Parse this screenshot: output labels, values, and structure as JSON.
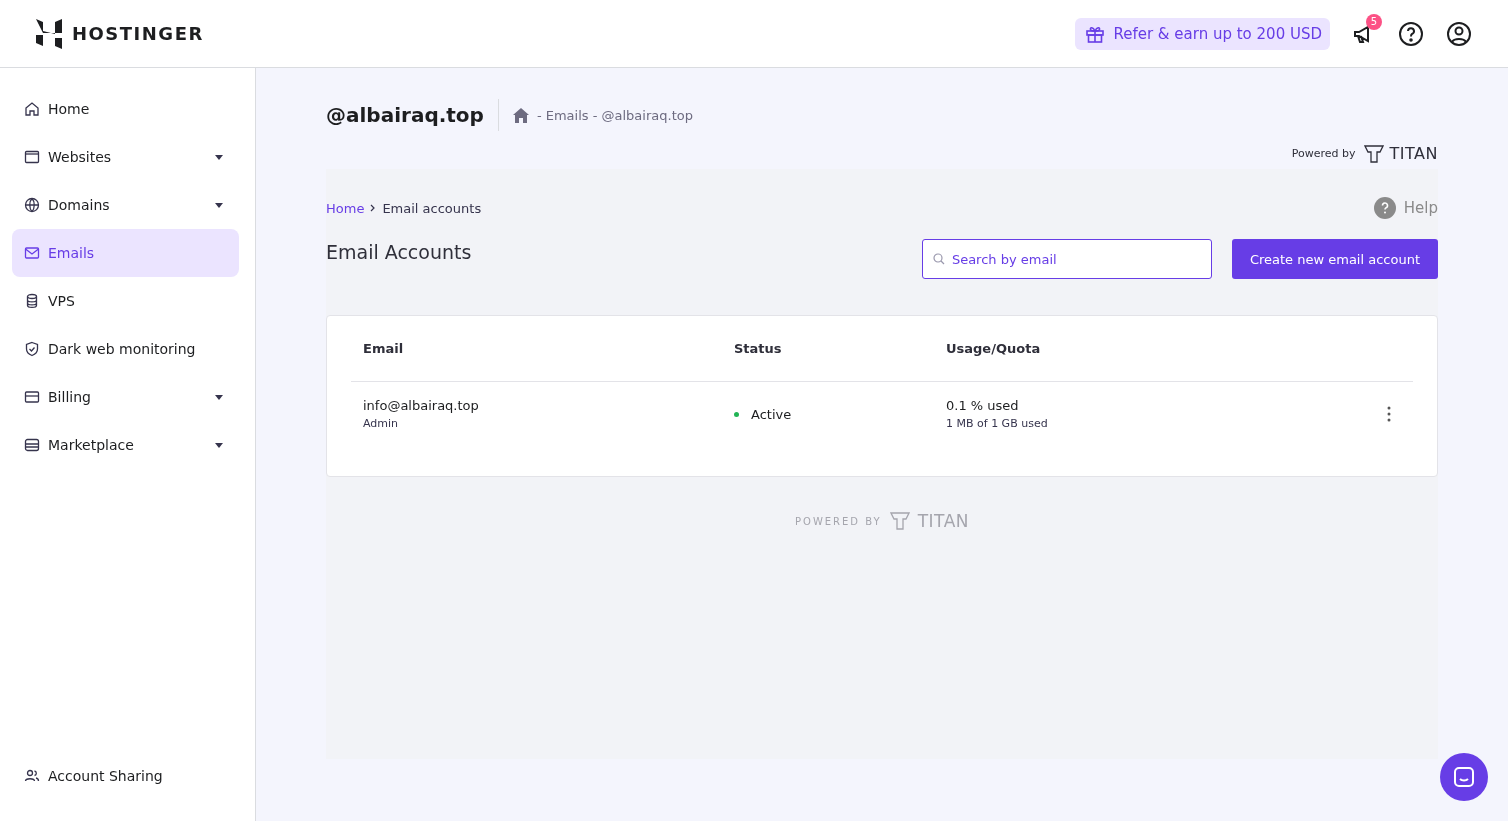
{
  "header": {
    "logo": "HOSTINGER",
    "refer": "Refer & earn up to 200 USD",
    "notification_count": "5"
  },
  "sidebar": {
    "items": [
      {
        "label": "Home",
        "kind": "home",
        "expandable": false,
        "selected": false
      },
      {
        "label": "Websites",
        "kind": "browser",
        "expandable": true,
        "selected": false
      },
      {
        "label": "Domains",
        "kind": "globe",
        "expandable": true,
        "selected": false
      },
      {
        "label": "Emails",
        "kind": "mail",
        "expandable": false,
        "selected": true
      },
      {
        "label": "VPS",
        "kind": "database",
        "expandable": false,
        "selected": false
      },
      {
        "label": "Dark web monitoring",
        "kind": "shield",
        "expandable": false,
        "selected": false
      },
      {
        "label": "Billing",
        "kind": "card",
        "expandable": true,
        "selected": false
      },
      {
        "label": "Marketplace",
        "kind": "store",
        "expandable": true,
        "selected": false
      }
    ],
    "footer_item": "Account Sharing"
  },
  "page": {
    "title": "@albairaq.top",
    "breadcrumb": "- Emails - @albairaq.top",
    "powered_by": "Powered by",
    "powered_brand": "TITAN"
  },
  "titan": {
    "crumbs": [
      "Home",
      "Email accounts"
    ],
    "help": "Help",
    "heading": "Email Accounts",
    "search": {
      "placeholder": "Search by email"
    },
    "create_button": "Create new email account",
    "table": {
      "columns": [
        "Email",
        "Status",
        "Usage/Quota"
      ],
      "rows": [
        {
          "email": "info@albairaq.top",
          "role": "Admin",
          "status": "Active",
          "color": "#22b455",
          "usage": "0.1 % used",
          "quota": "1 MB of 1 GB used"
        }
      ]
    },
    "footer_label": "POWERED BY",
    "footer_brand": "TITAN"
  }
}
